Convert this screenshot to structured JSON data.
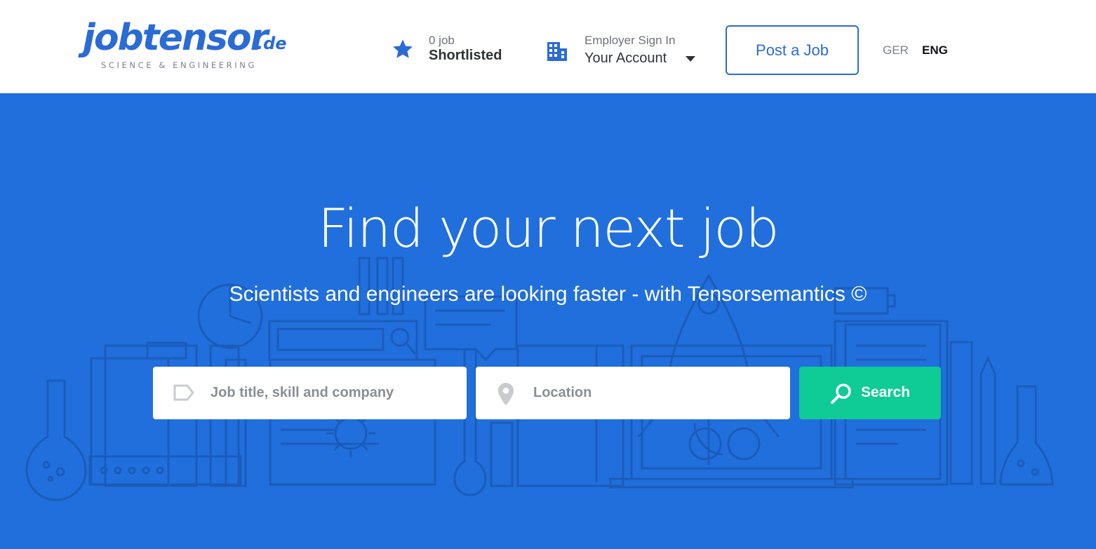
{
  "brand": {
    "name": "jobtensor",
    "tld": ".de",
    "tagline": "SCIENCE & ENGINEERING",
    "color": "#2a6bd6"
  },
  "header": {
    "shortlist": {
      "count": "0 job",
      "label": "Shortlisted",
      "icon": "star-icon"
    },
    "employer": {
      "small": "Employer Sign In",
      "label": "Your Account",
      "icon": "building-icon"
    },
    "post_job": "Post a Job",
    "languages": [
      "GER",
      "ENG"
    ],
    "active_language": "ENG"
  },
  "hero": {
    "title": "Find your next job",
    "subtitle": "Scientists and engineers are looking faster - with Tensorsemantics ©",
    "background": "#216fdc"
  },
  "search": {
    "job_placeholder": "Job title, skill and company",
    "location_placeholder": "Location",
    "button": "Search",
    "button_color": "#0fcb95"
  }
}
